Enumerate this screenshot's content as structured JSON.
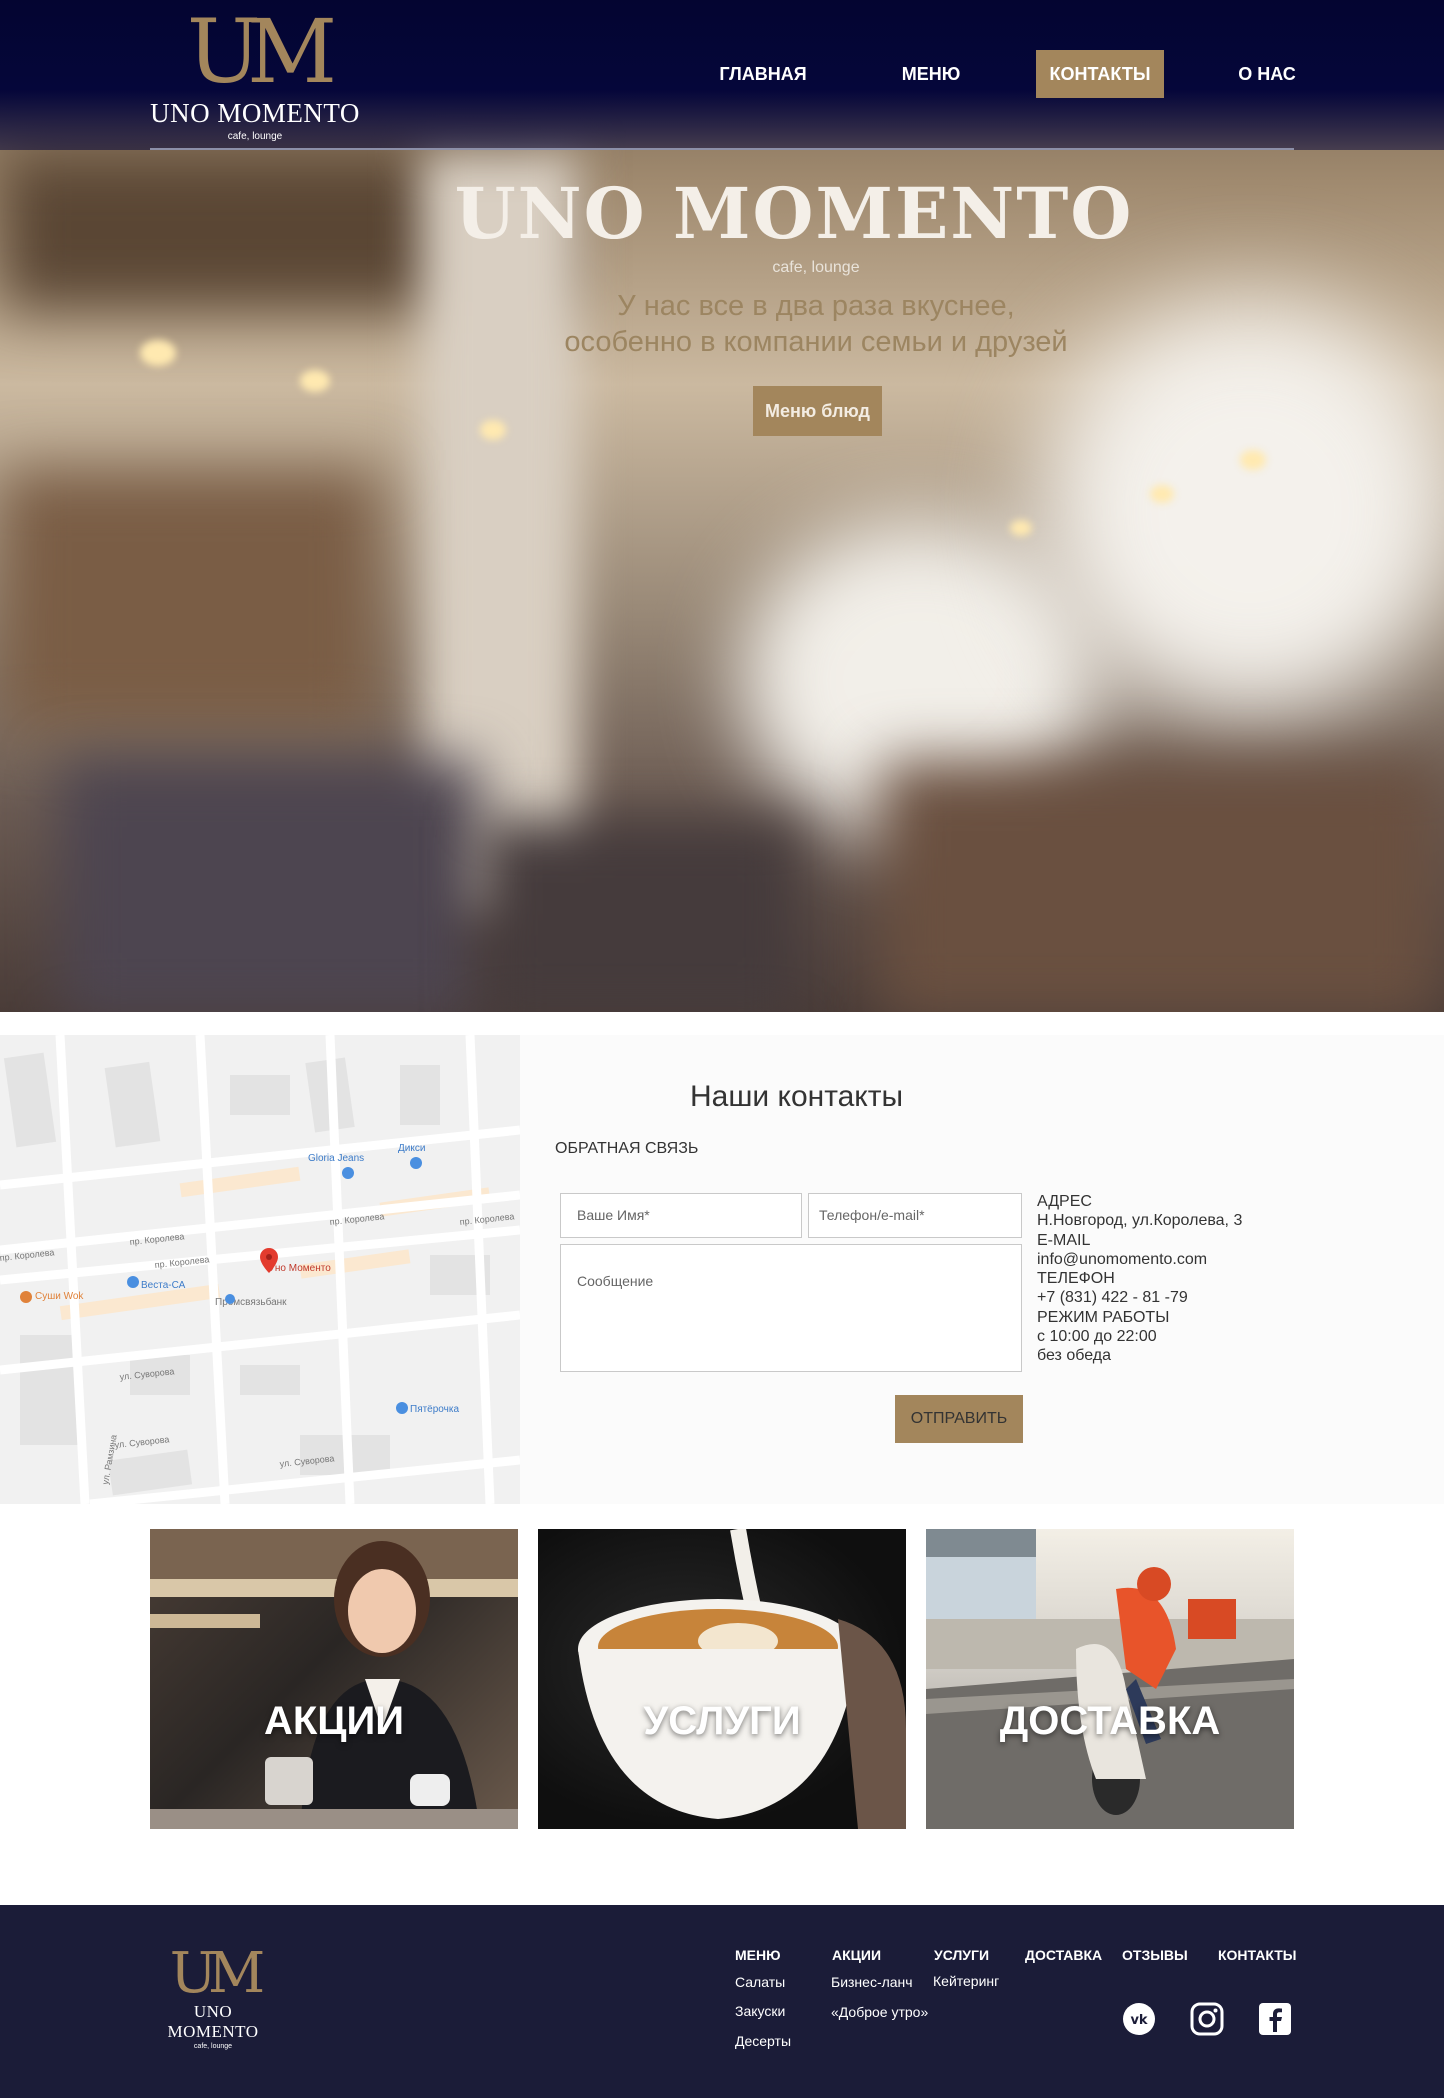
{
  "brand": {
    "mark": "UM",
    "name": "UNO MOMENTO",
    "tagline": "cafe, lounge"
  },
  "nav": {
    "items": [
      {
        "label": "ГЛАВНАЯ",
        "active": false
      },
      {
        "label": "МЕНЮ",
        "active": false
      },
      {
        "label": "КОНТАКТЫ",
        "active": true
      },
      {
        "label": "О НАС",
        "active": false
      }
    ]
  },
  "hero": {
    "title": "UNO MOMENTO",
    "subtitle": "cafe, lounge",
    "tagline_line1": "У нас все в два раза вкуснее,",
    "tagline_line2": "особенно в компании семьи и друзей",
    "button": "Меню блюд"
  },
  "map": {
    "labels": {
      "gloria": "Gloria Jeans",
      "diksi": "Дикси",
      "uno": "Уно Моменто",
      "vesta": "Веста-СА",
      "promsvyaz": "Промсвязьбанк",
      "sushi": "Суши Wok",
      "pyaterochka": "Пятёрочка",
      "street_koroleva_1": "пр. Королева",
      "street_koroleva_2": "пр. Королева",
      "street_koroleva_3": "пр. Королева",
      "street_koroleva_4": "пр. Королева",
      "street_koroleva_5": "пр. Королева",
      "street_suvorova_1": "ул. Суворова",
      "street_suvorova_2": "ул. Суворова",
      "street_suvorova_3": "ул. Суворова",
      "street_ramzina": "ул. Рамзина"
    }
  },
  "contacts": {
    "title": "Наши контакты",
    "feedback_label": "ОБРАТНАЯ СВЯЗЬ",
    "name_placeholder": "Ваше Имя*",
    "phone_placeholder": "Телефон/e-mail*",
    "message_placeholder": "Сообщение",
    "send_button": "ОТПРАВИТЬ",
    "info": {
      "address_label": "АДРЕС",
      "address": "Н.Новгород, ул.Королева, 3",
      "email_label": "E-MAIL",
      "email": "info@unomomento.com",
      "phone_label": "ТЕЛЕФОН",
      "phone": "+7 (831) 422 - 81 -79",
      "hours_label": "РЕЖИМ РАБОТЫ",
      "hours": "с 10:00 до 22:00",
      "hours_note": "без обеда"
    }
  },
  "tiles": [
    {
      "label": "АКЦИИ"
    },
    {
      "label": "УСЛУГИ"
    },
    {
      "label": "ДОСТАВКА"
    }
  ],
  "footer": {
    "columns": [
      {
        "head": "МЕНЮ",
        "links": [
          "Салаты",
          "Закуски",
          "Десерты"
        ]
      },
      {
        "head": "АКЦИИ",
        "links": [
          "Бизнес-ланч",
          "«Доброе утро»"
        ]
      },
      {
        "head": "УСЛУГИ",
        "links": [
          "Кейтеринг"
        ]
      },
      {
        "head": "ДОСТАВКА",
        "links": []
      },
      {
        "head": "ОТЗЫВЫ",
        "links": []
      },
      {
        "head": "КОНТАКТЫ",
        "links": []
      }
    ],
    "social": [
      "vk-icon",
      "instagram-icon",
      "facebook-icon"
    ]
  },
  "colors": {
    "navy": "#040531",
    "gold": "#a3865c",
    "footer": "#1b1c38",
    "panel": "#fbfbfb"
  }
}
